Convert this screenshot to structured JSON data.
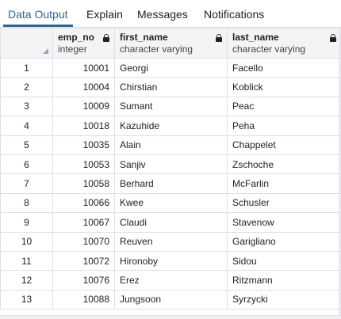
{
  "tabs": [
    {
      "label": "Data Output",
      "active": true
    },
    {
      "label": "Explain",
      "active": false
    },
    {
      "label": "Messages",
      "active": false
    },
    {
      "label": "Notifications",
      "active": false
    }
  ],
  "columns": [
    {
      "name": "emp_no",
      "type": "integer"
    },
    {
      "name": "first_name",
      "type": "character varying"
    },
    {
      "name": "last_name",
      "type": "character varying"
    }
  ],
  "rows": [
    {
      "n": "1",
      "emp_no": "10001",
      "first_name": "Georgi",
      "last_name": "Facello"
    },
    {
      "n": "2",
      "emp_no": "10004",
      "first_name": "Chirstian",
      "last_name": "Koblick"
    },
    {
      "n": "3",
      "emp_no": "10009",
      "first_name": "Sumant",
      "last_name": "Peac"
    },
    {
      "n": "4",
      "emp_no": "10018",
      "first_name": "Kazuhide",
      "last_name": "Peha"
    },
    {
      "n": "5",
      "emp_no": "10035",
      "first_name": "Alain",
      "last_name": "Chappelet"
    },
    {
      "n": "6",
      "emp_no": "10053",
      "first_name": "Sanjiv",
      "last_name": "Zschoche"
    },
    {
      "n": "7",
      "emp_no": "10058",
      "first_name": "Berhard",
      "last_name": "McFarlin"
    },
    {
      "n": "8",
      "emp_no": "10066",
      "first_name": "Kwee",
      "last_name": "Schusler"
    },
    {
      "n": "9",
      "emp_no": "10067",
      "first_name": "Claudi",
      "last_name": "Stavenow"
    },
    {
      "n": "10",
      "emp_no": "10070",
      "first_name": "Reuven",
      "last_name": "Garigliano"
    },
    {
      "n": "11",
      "emp_no": "10072",
      "first_name": "Hironoby",
      "last_name": "Sidou"
    },
    {
      "n": "12",
      "emp_no": "10076",
      "first_name": "Erez",
      "last_name": "Ritzmann"
    },
    {
      "n": "13",
      "emp_no": "10088",
      "first_name": "Jungsoon",
      "last_name": "Syrzycki"
    }
  ],
  "colors": {
    "accent": "#326690",
    "border": "#dde0e6",
    "header_bg": "#f3f4f6"
  }
}
